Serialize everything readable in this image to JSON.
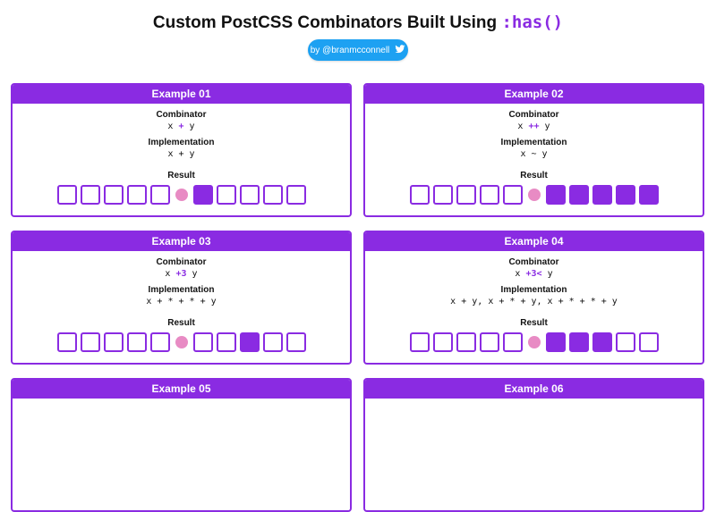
{
  "header": {
    "title": "Custom PostCSS Combinators Built Using",
    "title_code": ":has()",
    "byline": "by @branmcconnell"
  },
  "labels": {
    "combinator": "Combinator",
    "implementation": "Implementation",
    "result": "Result"
  },
  "colors": {
    "accent": "#8a2be2",
    "dot": "#e88bc4",
    "twitter": "#1da1f2"
  },
  "examples": [
    {
      "title": "Example 01",
      "combinator": {
        "x": "x",
        "op": "+",
        "y": "y"
      },
      "implementation": "x + y",
      "result": {
        "before": [
          0,
          0,
          0,
          0,
          0
        ],
        "after": [
          1,
          0,
          0,
          0,
          0
        ]
      }
    },
    {
      "title": "Example 02",
      "combinator": {
        "x": "x",
        "op": "++",
        "y": "y"
      },
      "implementation": "x ~ y",
      "result": {
        "before": [
          0,
          0,
          0,
          0,
          0
        ],
        "after": [
          1,
          1,
          1,
          1,
          1
        ]
      }
    },
    {
      "title": "Example 03",
      "combinator": {
        "x": "x",
        "op": "+3",
        "y": "y"
      },
      "implementation": "x + * + * + y",
      "result": {
        "before": [
          0,
          0,
          0,
          0,
          0
        ],
        "after": [
          0,
          0,
          1,
          0,
          0
        ]
      }
    },
    {
      "title": "Example 04",
      "combinator": {
        "x": "x",
        "op": "+3<",
        "y": "y"
      },
      "implementation": "x + y, x + * + y, x + * + * + y",
      "result": {
        "before": [
          0,
          0,
          0,
          0,
          0
        ],
        "after": [
          1,
          1,
          1,
          0,
          0
        ]
      }
    },
    {
      "title": "Example 05"
    },
    {
      "title": "Example 06"
    }
  ]
}
